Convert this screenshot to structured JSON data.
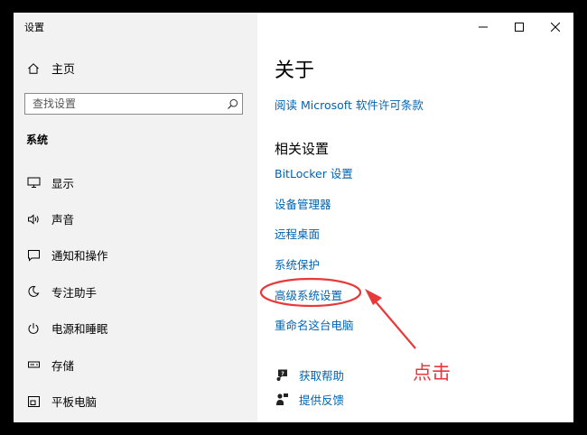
{
  "window": {
    "title": "设置",
    "controls": {
      "minimize_icon": "minimize-icon",
      "maximize_icon": "maximize-icon",
      "close_icon": "close-icon"
    }
  },
  "sidebar": {
    "home": {
      "label": "主页",
      "icon": "home-icon"
    },
    "search": {
      "placeholder": "查找设置",
      "value": "",
      "icon": "search-icon"
    },
    "section_label": "系统",
    "items": [
      {
        "label": "显示",
        "icon": "monitor-icon"
      },
      {
        "label": "声音",
        "icon": "speaker-icon"
      },
      {
        "label": "通知和操作",
        "icon": "notification-icon"
      },
      {
        "label": "专注助手",
        "icon": "moon-icon"
      },
      {
        "label": "电源和睡眠",
        "icon": "power-icon"
      },
      {
        "label": "存储",
        "icon": "storage-icon"
      },
      {
        "label": "平板电脑",
        "icon": "tablet-icon"
      }
    ]
  },
  "content": {
    "title": "关于",
    "license_link": "阅读 Microsoft 软件许可条款",
    "related_heading": "相关设置",
    "related_links": [
      "BitLocker 设置",
      "设备管理器",
      "远程桌面",
      "系统保护",
      "高级系统设置",
      "重命名这台电脑"
    ],
    "help": [
      {
        "label": "获取帮助",
        "icon": "help-chat-icon"
      },
      {
        "label": "提供反馈",
        "icon": "feedback-icon"
      }
    ]
  },
  "annotation": {
    "text": "点击",
    "color": "#e8383a"
  },
  "colors": {
    "link": "#0063b1",
    "sidebar_bg": "#f2f2f2",
    "frame": "#000000"
  }
}
